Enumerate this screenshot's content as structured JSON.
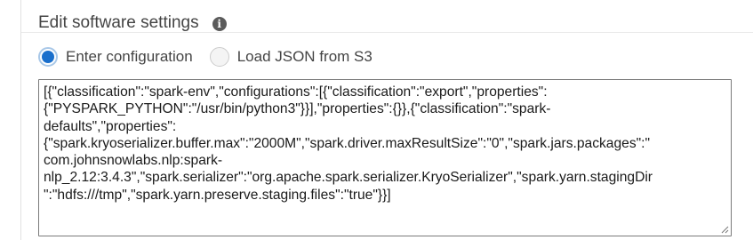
{
  "section": {
    "title": "Edit software settings",
    "info_icon": "info-icon"
  },
  "config_source": {
    "options": [
      {
        "label": "Enter configuration",
        "selected": true
      },
      {
        "label": "Load JSON from S3",
        "selected": false
      }
    ]
  },
  "configuration": {
    "lines": [
      "[{\"classification\":\"spark-env\",\"configurations\":[{\"classification\":\"export\",\"properties\":",
      "{\"PYSPARK_PYTHON\":\"/usr/bin/python3\"}}],\"properties\":{}},{\"classification\":\"spark-",
      "defaults\",\"properties\":",
      "{\"spark.kryoserializer.buffer.max\":\"2000M\",\"spark.driver.maxResultSize\":\"0\",\"spark.jars.packages\":\"",
      "com.johnsnowlabs.nlp:spark-",
      "nlp_2.12:3.4.3\",\"spark.serializer\":\"org.apache.spark.serializer.KryoSerializer\",\"spark.yarn.stagingDir",
      "\":\"hdfs:///tmp\",\"spark.yarn.preserve.staging.files\":\"true\"}}]"
    ]
  },
  "colors": {
    "accent": "#1a6fcc",
    "text": "#444444",
    "border": "#7a7a7a"
  }
}
